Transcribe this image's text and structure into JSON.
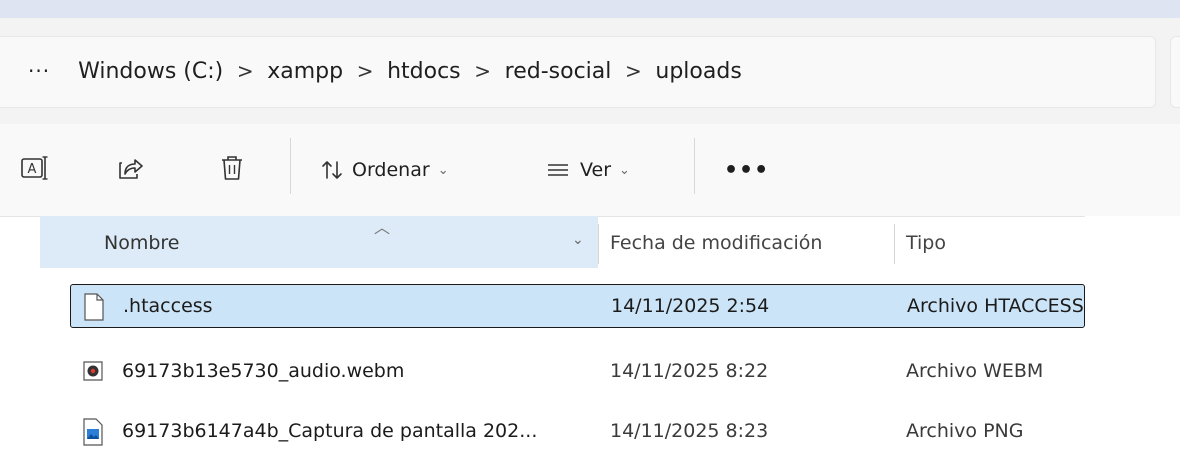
{
  "breadcrumb": {
    "overflow_label": "···",
    "items": [
      "Windows (C:)",
      "xampp",
      "htdocs",
      "red-social",
      "uploads"
    ],
    "separator": ">"
  },
  "toolbar": {
    "sort_label": "Ordenar",
    "view_label": "Ver",
    "more_label": "•••"
  },
  "columns": {
    "name": "Nombre",
    "date": "Fecha de modificación",
    "type": "Tipo"
  },
  "files": [
    {
      "name": ".htaccess",
      "date": "14/11/2025 2:54",
      "type": "Archivo HTACCESS",
      "icon": "generic-file-icon",
      "selected": true
    },
    {
      "name": "69173b13e5730_audio.webm",
      "date": "14/11/2025 8:22",
      "type": "Archivo WEBM",
      "icon": "media-file-icon",
      "selected": false
    },
    {
      "name": "69173b6147a4b_Captura de pantalla 202...",
      "date": "14/11/2025 8:23",
      "type": "Archivo PNG",
      "icon": "image-file-icon",
      "selected": false
    }
  ],
  "colors": {
    "selection": "#cce4f7",
    "header_highlight": "#ddeaf7",
    "accent": "#0067c0"
  }
}
